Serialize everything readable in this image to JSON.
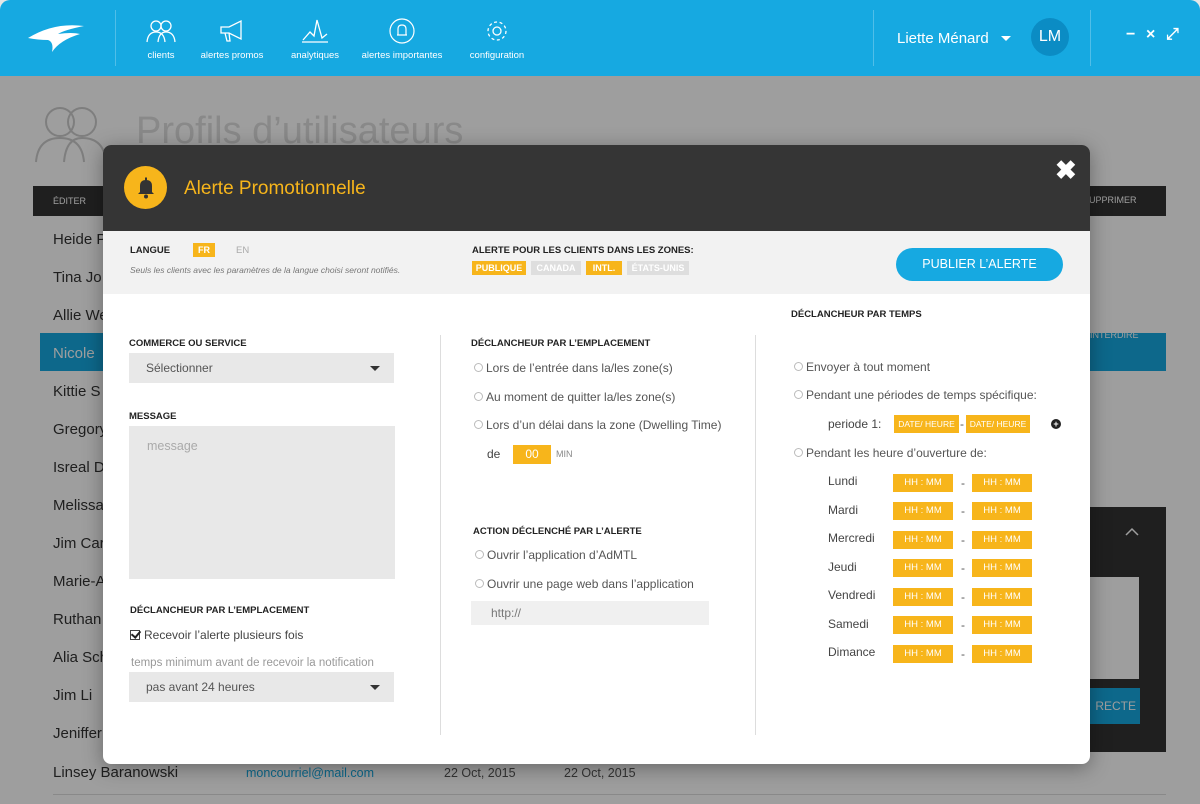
{
  "topbar": {
    "nav": [
      {
        "label": "clients",
        "icon": "clients-icon"
      },
      {
        "label": "alertes promos",
        "icon": "megaphone-icon"
      },
      {
        "label": "analytiques",
        "icon": "analytics-icon"
      },
      {
        "label": "alertes importantes",
        "icon": "bell-icon"
      },
      {
        "label": "configuration",
        "icon": "gear-icon"
      }
    ],
    "user_name": "Liette Ménard",
    "avatar_initials": "LM",
    "window_controls": {
      "minimize": "−",
      "close": "×",
      "expand": "⤢"
    }
  },
  "background": {
    "page_title": "Profils d’utilisateurs",
    "table_head_first": "ÉDITER",
    "table_head_right": "SUPPRIMER",
    "rows": [
      "Heide P",
      "Tina Jo",
      "Allie We",
      "Nicole",
      "Kittie S",
      "Gregory",
      "Isreal D",
      "Melissa",
      "Jim Car",
      "Marie-A",
      "Ruthan",
      "Alia Sch",
      "Jim Li",
      "Jeniffer",
      "Linsey Baranowski"
    ],
    "last_row": {
      "email": "moncourriel@mail.com",
      "date1": "22 Oct, 2015",
      "date2": "22 Oct, 2015"
    },
    "highlight_right": "INTERDIRE",
    "panel_button": "RECTE"
  },
  "modal": {
    "title": "Alerte Promotionnelle",
    "close": "✖",
    "language": {
      "label": "LANGUE",
      "options": [
        "FR",
        "EN"
      ],
      "selected": "FR",
      "note": "Seuls les clients avec les paramètres de la langue choisi seront notifiés."
    },
    "zones": {
      "label": "ALERTE POUR LES CLIENTS DANS LES ZONES:",
      "options": [
        {
          "label": "PUBLIQUE",
          "active": true
        },
        {
          "label": "CANADA",
          "active": false
        },
        {
          "label": "INTL.",
          "active": true
        },
        {
          "label": "ÉTATS-UNIS",
          "active": false
        }
      ]
    },
    "publish_button": "PUBLIER L’ALERTE",
    "col1": {
      "commerce_label": "COMMERCE OU SERVICE",
      "commerce_value": "Sélectionner",
      "message_label": "MESSAGE",
      "message_placeholder": "message",
      "trigger_label": "DÉCLANCHEUR  PAR L’EMPLACEMENT",
      "repeat_checkbox": "Recevoir l’alerte plusieurs fois",
      "min_time_label": "temps minimum avant de recevoir la notification",
      "min_time_value": "pas avant 24 heures"
    },
    "col2": {
      "location_label": "DÉCLANCHEUR  PAR L’EMPLACEMENT",
      "location_options": [
        "Lors de l’entrée dans la/les zone(s)",
        "Au moment de quitter la/les zone(s)",
        "Lors d’un délai dans la zone (Dwelling Time)"
      ],
      "delay_prefix": "de",
      "delay_value": "00",
      "delay_unit": "MIN",
      "action_label": "ACTION  DÉCLENCHÉ PAR L’ALERTE",
      "action_options": [
        "Ouvrir l’application d’AdMTL",
        "Ouvrir une page web dans l’application"
      ],
      "url_value": "http://"
    },
    "col3": {
      "time_label": "DÉCLANCHEUR  PAR TEMPS",
      "opt_anytime": "Envoyer à tout moment",
      "opt_specific": "Pendant une périodes de temps spécifique:",
      "period_label": "periode 1:",
      "date_placeholder": "DATE/ HEURE",
      "opt_hours": "Pendant les heure d’ouverture de:",
      "days": [
        "Lundi",
        "Mardi",
        "Mercredi",
        "Jeudi",
        "Vendredi",
        "Samedi",
        "Dimance"
      ],
      "time_placeholder": "HH : MM",
      "separator": "-"
    }
  }
}
